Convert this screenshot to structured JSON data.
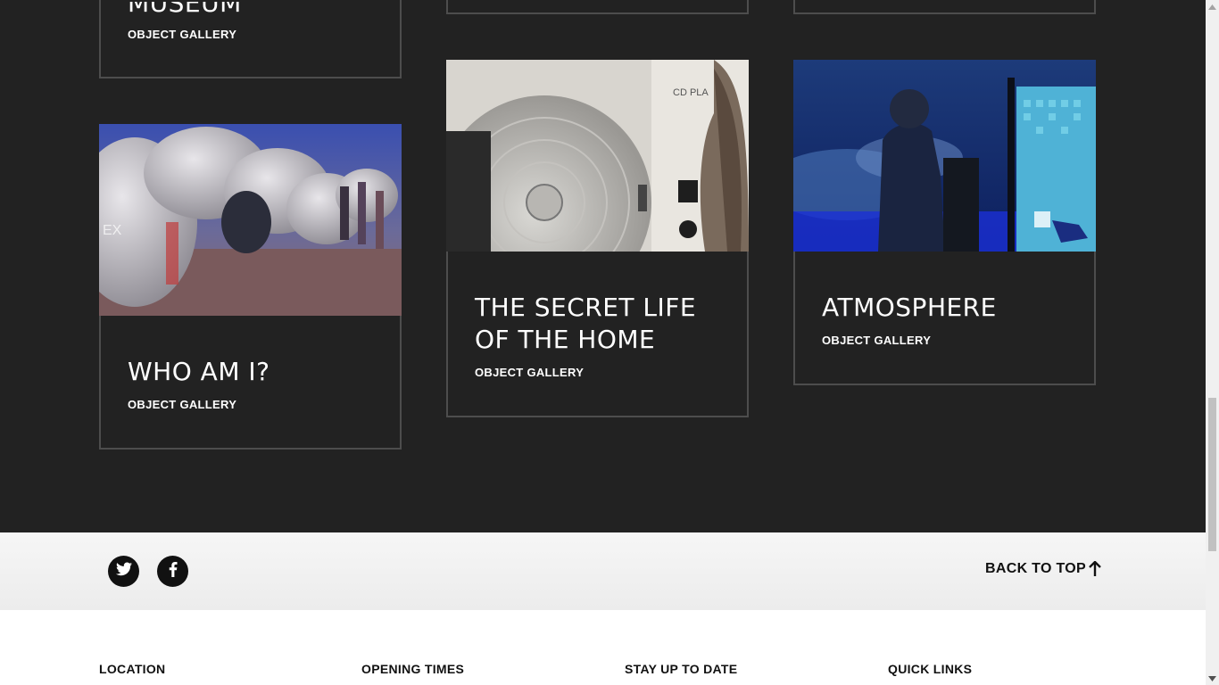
{
  "cards": [
    {
      "title": "MUSEUM",
      "subtitle": "OBJECT GALLERY"
    },
    {
      "title": "WHO AM I?",
      "subtitle": "OBJECT GALLERY"
    },
    {
      "title": "THE SECRET LIFE OF THE HOME",
      "subtitle": "OBJECT GALLERY"
    },
    {
      "title": "ATMOSPHERE",
      "subtitle": "OBJECT GALLERY"
    }
  ],
  "footer": {
    "back_to_top": "BACK TO TOP",
    "social": [
      "twitter-icon",
      "facebook-icon"
    ],
    "headings": [
      "LOCATION",
      "OPENING TIMES",
      "STAY UP TO DATE",
      "QUICK LINKS"
    ]
  },
  "colors": {
    "background": "#222222",
    "card_border": "#4d4d4d",
    "footer_band": "#f2f2f2",
    "text_light": "#ffffff",
    "text_dark": "#111111"
  }
}
